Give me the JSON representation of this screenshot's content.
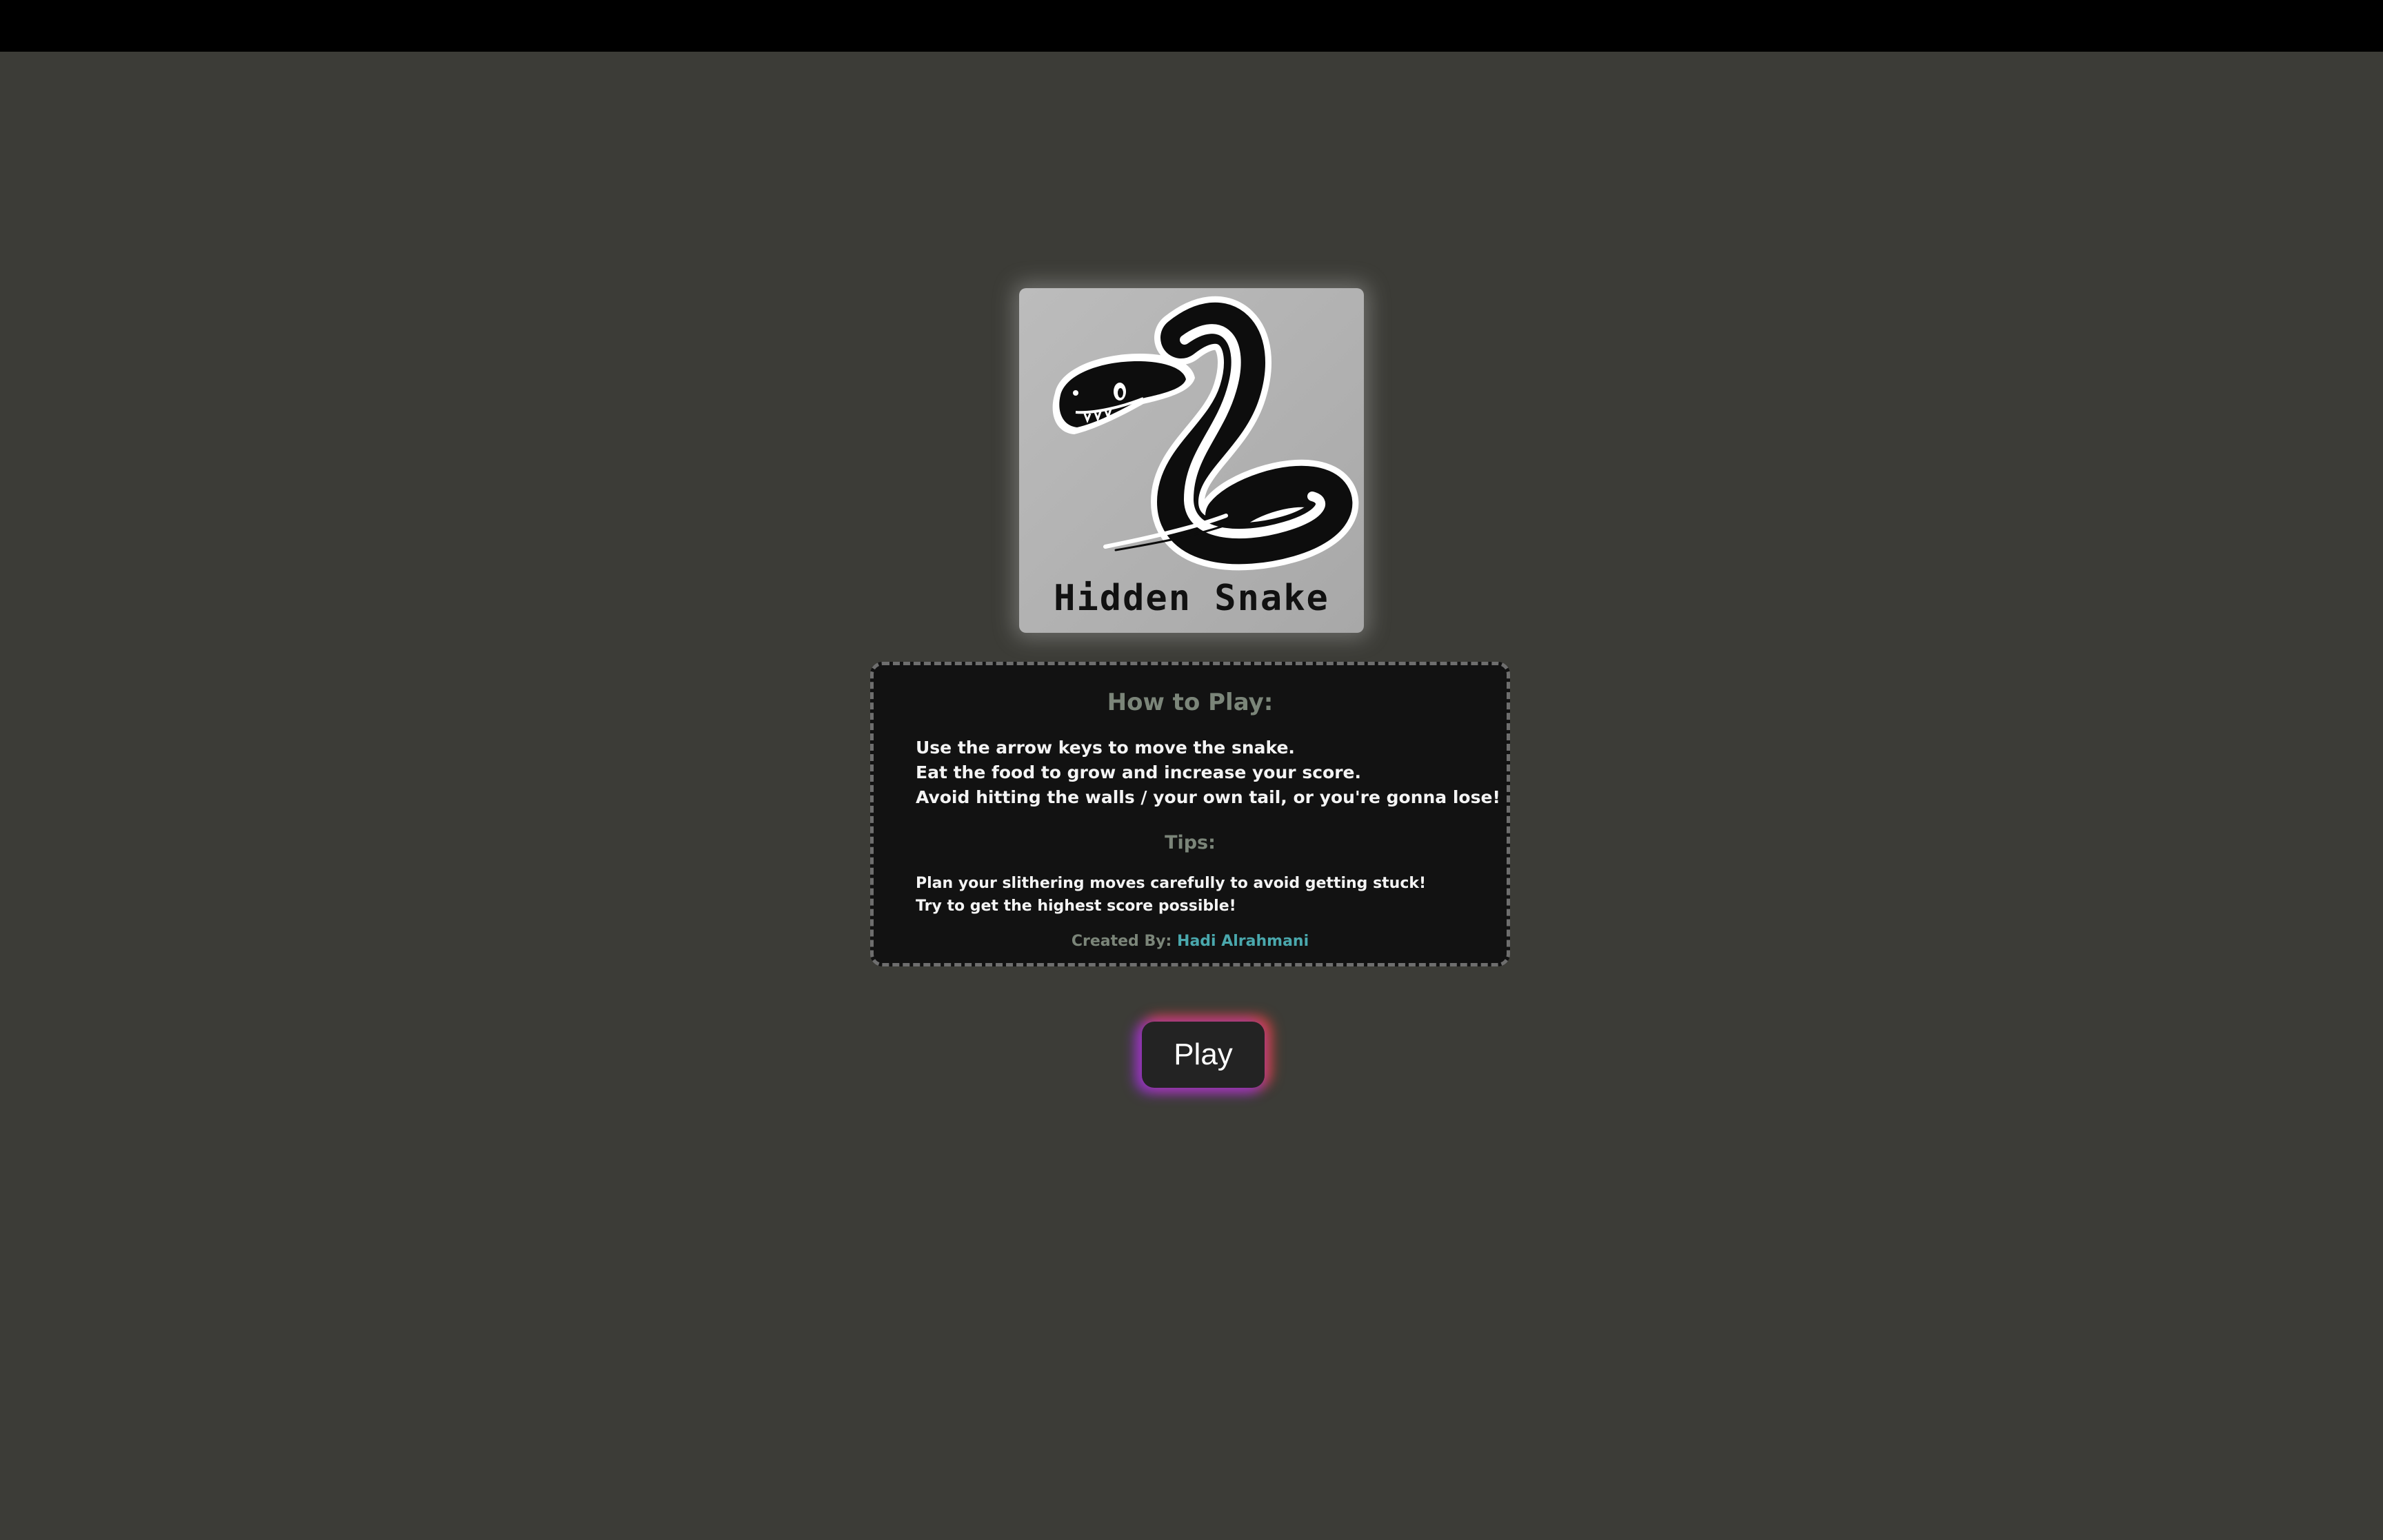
{
  "logo": {
    "text": "Hidden Snake",
    "icon": "snake-icon"
  },
  "how_to_play": {
    "title": "How to Play:",
    "instructions": [
      "Use the arrow keys to move the snake.",
      "Eat the food to grow and increase your score.",
      "Avoid hitting the walls / your own tail, or you're gonna lose!"
    ],
    "tips_title": "Tips:",
    "tips": [
      "Plan your slithering moves carefully to avoid getting stuck!",
      "Try to get the highest score possible!"
    ],
    "credit_label": "Created By:",
    "credit_author": "Hadi Alrahmani"
  },
  "play_button": {
    "label": "Play"
  },
  "colors": {
    "background": "#3c3c37",
    "panel": "#121212",
    "heading": "#7b8579",
    "link": "#4aa8ad"
  }
}
